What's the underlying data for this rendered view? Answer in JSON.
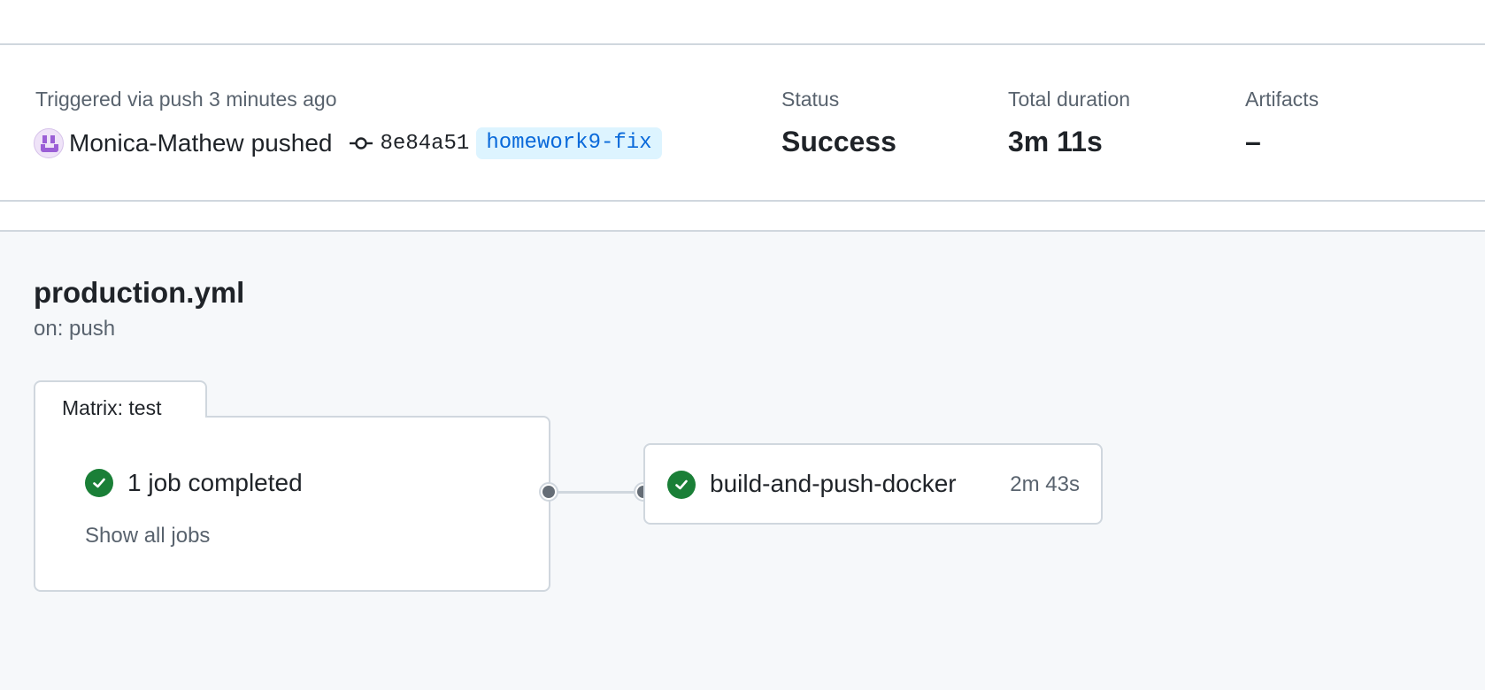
{
  "run": {
    "trigger_text": "Triggered via push 3 minutes ago",
    "actor": "Monica-Mathew",
    "action": "pushed",
    "commit_sha": "8e84a51",
    "branch": "homework9-fix"
  },
  "meta": {
    "status_label": "Status",
    "status_value": "Success",
    "duration_label": "Total duration",
    "duration_value": "3m 11s",
    "artifacts_label": "Artifacts",
    "artifacts_value": "–"
  },
  "workflow": {
    "file": "production.yml",
    "trigger": "on: push",
    "matrix": {
      "title": "Matrix: test",
      "summary": "1 job completed",
      "show_all": "Show all jobs"
    },
    "job": {
      "name": "build-and-push-docker",
      "duration": "2m 43s"
    }
  },
  "colors": {
    "success": "#1a7f37",
    "branch_bg": "#ddf4ff",
    "branch_fg": "#0969da",
    "graph_bg": "#f6f8fa"
  },
  "icons": {
    "avatar": "identicon-avatar",
    "commit": "git-commit-icon",
    "status": "check-circle-icon"
  }
}
